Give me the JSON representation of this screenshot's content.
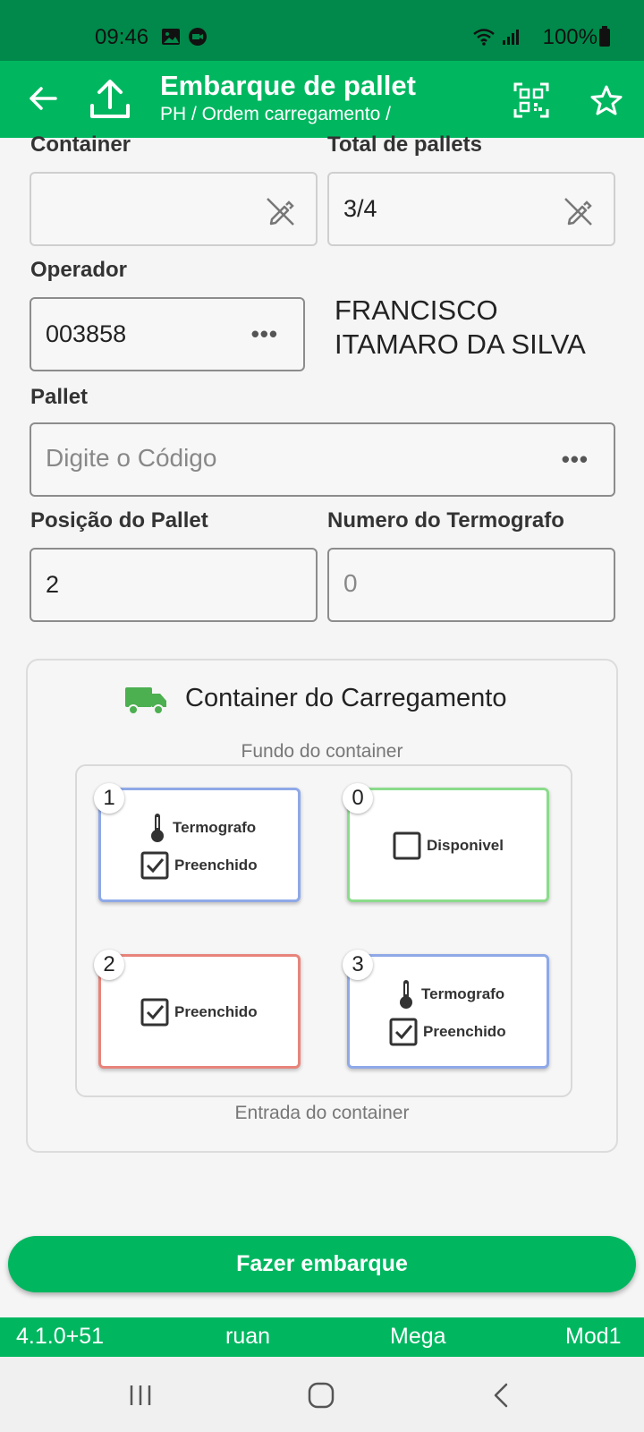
{
  "status_bar": {
    "time": "09:46",
    "battery": "100%"
  },
  "app_bar": {
    "title": "Embarque de pallet",
    "subtitle": "PH / Ordem carregamento /",
    "icons": [
      "back-arrow-icon",
      "upload-icon",
      "qr-code-icon",
      "star-icon"
    ]
  },
  "form": {
    "container": {
      "label": "Container",
      "value": ""
    },
    "total_pallets": {
      "label": "Total de pallets",
      "value": "3/4"
    },
    "operador": {
      "label": "Operador",
      "value": "003858",
      "name": "FRANCISCO ITAMARO DA SILVA"
    },
    "pallet": {
      "label": "Pallet",
      "placeholder": "Digite o Código"
    },
    "posicao": {
      "label": "Posição do Pallet",
      "value": "2"
    },
    "termografo": {
      "label": "Numero do Termografo",
      "placeholder": "0"
    }
  },
  "container_panel": {
    "title": "Container do Carregamento",
    "top_label": "Fundo do container",
    "bottom_label": "Entrada do container",
    "slots": [
      {
        "number": "1",
        "color": "#8fa9e8",
        "termografo": "Termografo",
        "status": "Preenchido"
      },
      {
        "number": "0",
        "color": "#8bdc8b",
        "status": "Disponivel"
      },
      {
        "number": "2",
        "color": "#e8847b",
        "status": "Preenchido"
      },
      {
        "number": "3",
        "color": "#8fa9e8",
        "termografo": "Termografo",
        "status": "Preenchido"
      }
    ]
  },
  "primary_button": {
    "label": "Fazer embarque"
  },
  "footer": {
    "version": "4.1.0+51",
    "user": "ruan",
    "company": "Mega",
    "module": "Mod1"
  },
  "colors": {
    "primary": "#00b760",
    "status_bar": "#00894a"
  }
}
